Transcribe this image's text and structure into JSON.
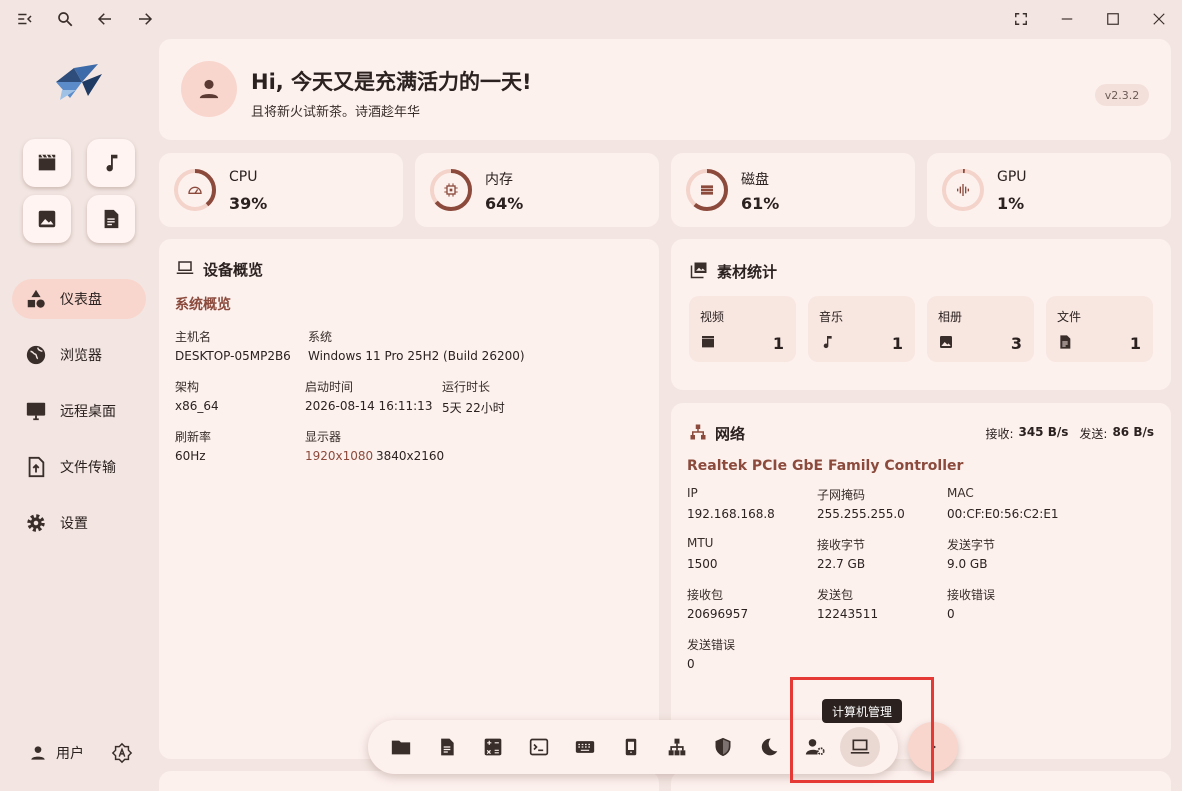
{
  "header": {
    "greeting": "Hi, 今天又是充满活力的一天!",
    "subtitle": "且将新火试新茶。诗酒趁年华",
    "version": "v2.3.2"
  },
  "sidebar": {
    "items": [
      {
        "label": "仪表盘",
        "icon": "dashboard-icon"
      },
      {
        "label": "浏览器",
        "icon": "globe-icon"
      },
      {
        "label": "远程桌面",
        "icon": "monitor-icon"
      },
      {
        "label": "文件传输",
        "icon": "file-upload-icon"
      },
      {
        "label": "设置",
        "icon": "gear-icon"
      }
    ],
    "user_label": "用户"
  },
  "stats": [
    {
      "name": "CPU",
      "value": "39%",
      "fraction": 0.39
    },
    {
      "name": "内存",
      "value": "64%",
      "fraction": 0.64
    },
    {
      "name": "磁盘",
      "value": "61%",
      "fraction": 0.61
    },
    {
      "name": "GPU",
      "value": "1%",
      "fraction": 0.01
    }
  ],
  "device": {
    "title": "设备概览",
    "section": "系统概览",
    "hostname_label": "主机名",
    "hostname": "DESKTOP-05MP2B6",
    "os_label": "系统",
    "os": "Windows 11 Pro 25H2 (Build 26200)",
    "arch_label": "架构",
    "arch": "x86_64",
    "boot_label": "启动时间",
    "boot": "2026-08-14 16:11:13",
    "uptime_label": "运行时长",
    "uptime": "5天 22小时",
    "refresh_label": "刷新率",
    "refresh": "60Hz",
    "display_label": "显示器",
    "display_primary": "1920x1080",
    "display_secondary": "3840x2160"
  },
  "materials": {
    "title": "素材统计",
    "items": [
      {
        "label": "视频",
        "count": "1"
      },
      {
        "label": "音乐",
        "count": "1"
      },
      {
        "label": "相册",
        "count": "3"
      },
      {
        "label": "文件",
        "count": "1"
      }
    ]
  },
  "network": {
    "title": "网络",
    "recv_label": "接收:",
    "recv": "345 B/s",
    "send_label": "发送:",
    "send": "86 B/s",
    "adapter": "Realtek PCIe GbE Family Controller",
    "ip_label": "IP",
    "ip": "192.168.168.8",
    "mask_label": "子网掩码",
    "mask": "255.255.255.0",
    "mac_label": "MAC",
    "mac": "00:CF:E0:56:C2:E1",
    "mtu_label": "MTU",
    "mtu": "1500",
    "rx_bytes_label": "接收字节",
    "rx_bytes": "22.7 GB",
    "tx_bytes_label": "发送字节",
    "tx_bytes": "9.0 GB",
    "rx_pkts_label": "接收包",
    "rx_pkts": "20696957",
    "tx_pkts_label": "发送包",
    "tx_pkts": "12243511",
    "rx_err_label": "接收错误",
    "rx_err": "0",
    "tx_err_label": "发送错误",
    "tx_err": "0"
  },
  "dock": {
    "tooltip": "计算机管理",
    "items": [
      "folder-icon",
      "document-icon",
      "calculator-icon",
      "terminal-icon",
      "keyboard-icon",
      "phone-icon",
      "network-tree-icon",
      "shield-icon",
      "moon-icon",
      "user-settings-icon",
      "laptop-icon"
    ]
  },
  "colors": {
    "accent": "#8b4a3c",
    "ring_track": "#f3d3ca",
    "highlight": "#e53935"
  }
}
